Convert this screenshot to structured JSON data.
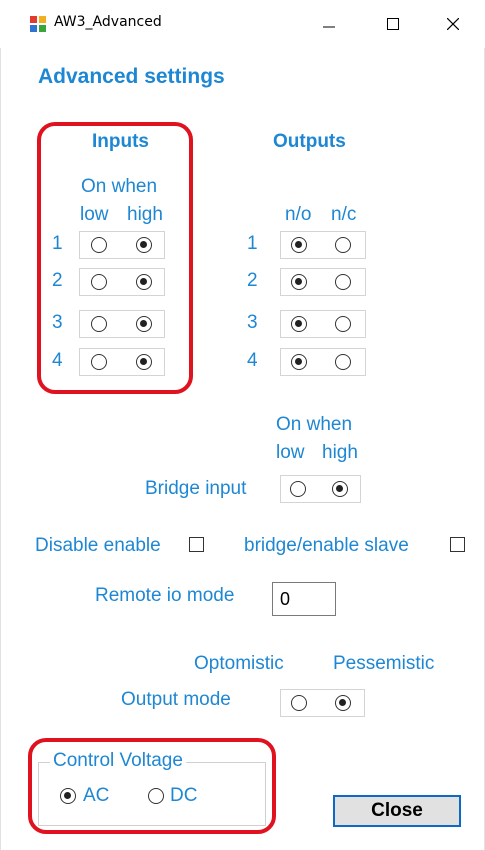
{
  "window": {
    "title": "AW3_Advanced"
  },
  "heading": "Advanced settings",
  "inputs": {
    "title": "Inputs",
    "on_when": "On when",
    "col_low": "low",
    "col_high": "high",
    "rows": [
      {
        "num": "1",
        "selected": "high"
      },
      {
        "num": "2",
        "selected": "high"
      },
      {
        "num": "3",
        "selected": "high"
      },
      {
        "num": "4",
        "selected": "high"
      }
    ]
  },
  "outputs": {
    "title": "Outputs",
    "col_no": "n/o",
    "col_nc": "n/c",
    "rows": [
      {
        "num": "1",
        "selected": "n/o"
      },
      {
        "num": "2",
        "selected": "n/o"
      },
      {
        "num": "3",
        "selected": "n/o"
      },
      {
        "num": "4",
        "selected": "n/o"
      }
    ]
  },
  "bridge": {
    "on_when": "On when",
    "col_low": "low",
    "col_high": "high",
    "label": "Bridge input",
    "selected": "high"
  },
  "disable_enable": {
    "label": "Disable enable",
    "checked": false
  },
  "bridge_enable_slave": {
    "label": "bridge/enable slave",
    "checked": false
  },
  "remote_io": {
    "label": "Remote io mode",
    "value": "0"
  },
  "output_mode": {
    "label": "Output mode",
    "opt1": "Optomistic",
    "opt2": "Pessemistic",
    "selected": "Pessemistic"
  },
  "control_voltage": {
    "legend": "Control Voltage",
    "opt_ac": "AC",
    "opt_dc": "DC",
    "selected": "AC"
  },
  "close_button": "Close",
  "colors": {
    "label_blue": "#1e87d3",
    "highlight_red": "#e0121f",
    "button_border": "#0c69c6"
  }
}
